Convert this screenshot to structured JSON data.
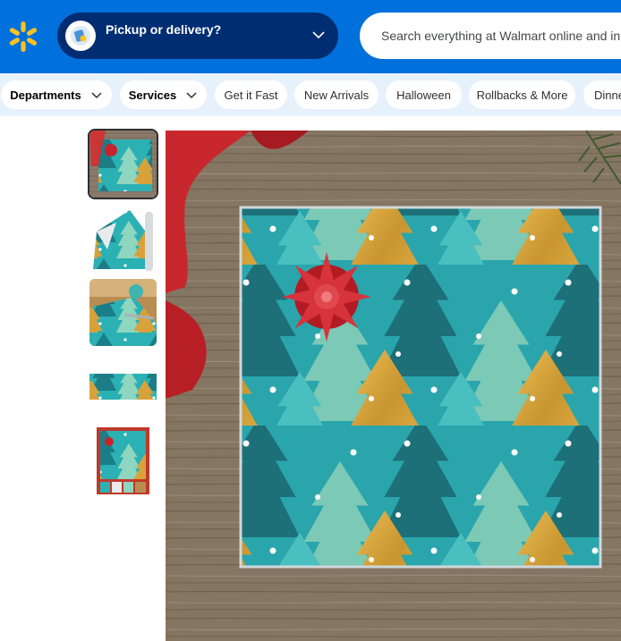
{
  "header": {
    "brand_color": "#0071dc",
    "pickup_label": "Pickup or delivery?",
    "search_placeholder": "Search everything at Walmart online and in store"
  },
  "nav": {
    "items": [
      {
        "label": "Departments",
        "dropdown": true
      },
      {
        "label": "Services",
        "dropdown": true
      },
      {
        "label": "Get it Fast"
      },
      {
        "label": "New Arrivals"
      },
      {
        "label": "Halloween"
      },
      {
        "label": "Rollbacks & More"
      },
      {
        "label": "Dinner Made Easy"
      }
    ]
  },
  "gallery": {
    "thumbnails": [
      {
        "name": "wrapped-gift-thumbnail",
        "selected": true
      },
      {
        "name": "paper-roll-thumbnail"
      },
      {
        "name": "crafting-thumbnail"
      },
      {
        "name": "paper-strip-thumbnail"
      },
      {
        "name": "collage-thumbnail"
      }
    ],
    "main_image": "wrapped-gift-photo"
  }
}
